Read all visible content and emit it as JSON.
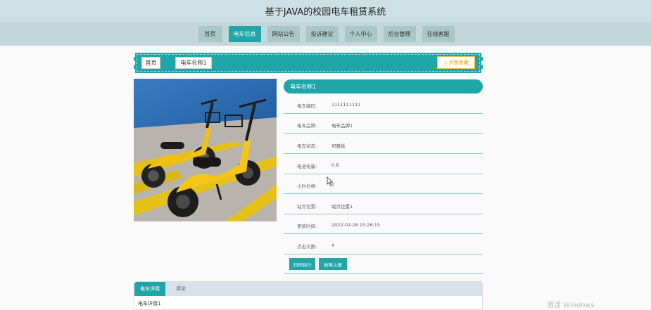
{
  "site": {
    "title": "基于JAVA的校园电车租赁系统"
  },
  "nav": {
    "items": [
      {
        "label": "首页",
        "active": false
      },
      {
        "label": "电车信息",
        "active": true
      },
      {
        "label": "网站公告",
        "active": false
      },
      {
        "label": "投诉建议",
        "active": false
      },
      {
        "label": "个人中心",
        "active": false
      },
      {
        "label": "后台管理",
        "active": false
      },
      {
        "label": "在线客服",
        "active": false
      }
    ]
  },
  "breadcrumb": {
    "home": "首页",
    "current": "电车名称1",
    "favorite_icon": "☆",
    "favorite_label": "点我收藏"
  },
  "detail": {
    "heading": "电车名称1",
    "rows": [
      {
        "key": "电车编码:",
        "value": "1111111111"
      },
      {
        "key": "电车品牌:",
        "value": "电车品牌1"
      },
      {
        "key": "电车状态:",
        "value": "可租赁"
      },
      {
        "key": "电池电量:",
        "value": "0.8"
      },
      {
        "key": "小时价格:",
        "value": "1"
      },
      {
        "key": "站点位置:",
        "value": "站点位置1"
      },
      {
        "key": "更新时间:",
        "value": "2022-02-28 15:26:15"
      },
      {
        "key": "点击次数:",
        "value": "4"
      }
    ],
    "actions": {
      "scan": "扫码骑行",
      "fault": "故障上报"
    }
  },
  "tabs": {
    "items": [
      "电车详情",
      "评论"
    ],
    "active": 0,
    "content": "电车详情1"
  },
  "watermark": {
    "text": "激活 Windows"
  },
  "colors": {
    "accent": "#20a5a8",
    "nav_bg": "#c3d7da",
    "title_bg": "#cde0e3",
    "nav_item": "#a9c7c7"
  }
}
